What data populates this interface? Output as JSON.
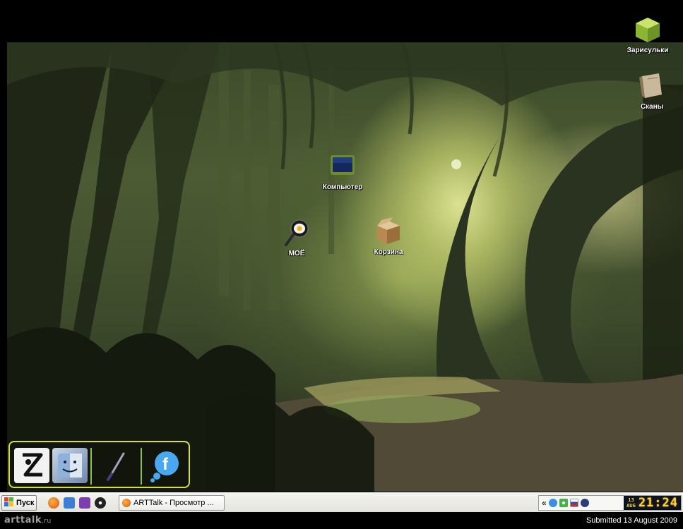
{
  "desktop": {
    "icons": [
      {
        "label": "Зарисульки",
        "icon": "green-cube-icon"
      },
      {
        "label": "Сканы",
        "icon": "book-icon"
      },
      {
        "label": "Компьютер",
        "icon": "monitor-icon"
      },
      {
        "label": "МОЁ",
        "icon": "egg-pan-icon"
      },
      {
        "label": "Корзина",
        "icon": "cardboard-box-icon"
      }
    ]
  },
  "dock": {
    "items": [
      "zbrush-icon",
      "finder-icon",
      "brush-icon",
      "facebook-bubble-icon"
    ],
    "facebook_glyph": "f"
  },
  "taskbar": {
    "start_label": "Пуск",
    "window_title": "ARTTalk - Просмотр ...",
    "tray_expand": "«",
    "tray_icons": [
      "facebook-tray-icon",
      "flower-tray-icon",
      "russian-flag-icon",
      "play-tray-icon"
    ],
    "clock": {
      "day": "13",
      "month": "AUG",
      "time": "21:24"
    }
  },
  "footer": {
    "logo_main": "arttalk",
    "logo_suffix": ".ru",
    "submitted": "Submitted 13 August 2009"
  },
  "colors": {
    "dock_border": "#d8df3a",
    "clock_digits": "#ffd23a",
    "taskbar_bg": "#f0f0ec"
  }
}
